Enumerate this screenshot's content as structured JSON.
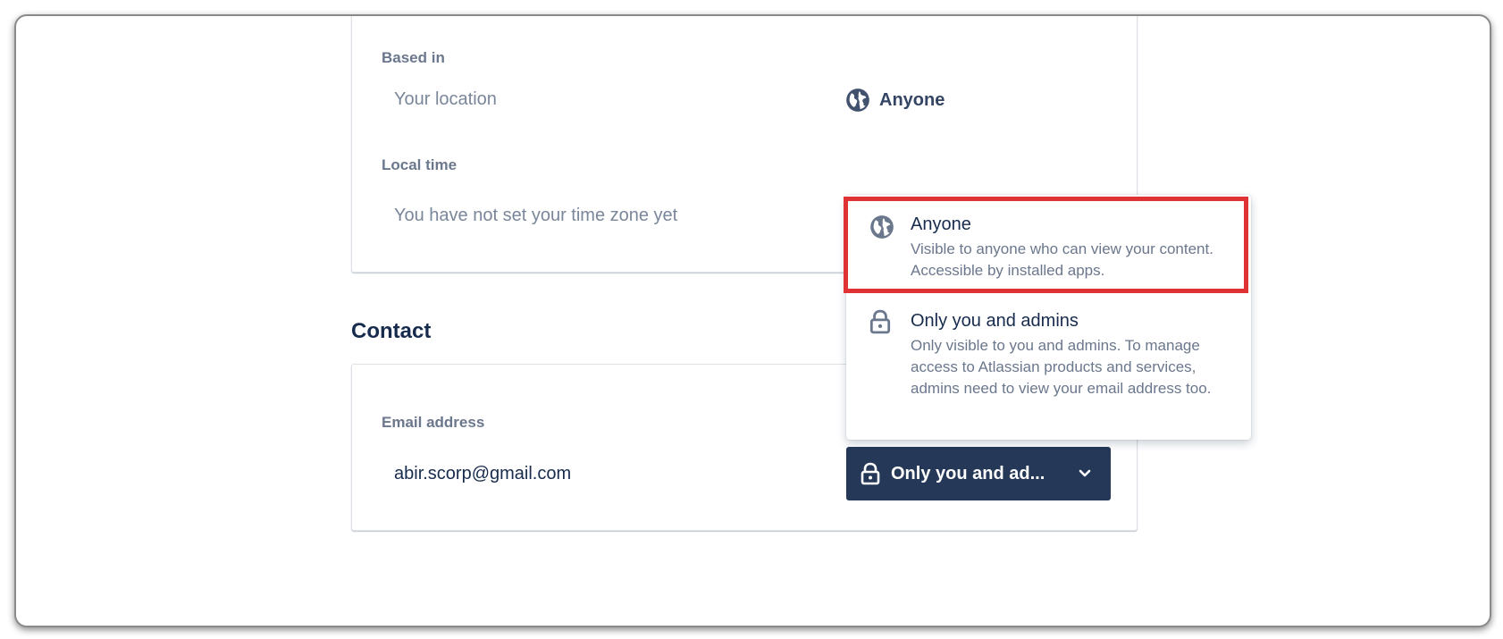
{
  "profile": {
    "based_in": {
      "label": "Based in",
      "placeholder": "Your location",
      "visibility": "Anyone"
    },
    "local_time": {
      "label": "Local time",
      "placeholder": "You have not set your time zone yet"
    }
  },
  "contact": {
    "section_title": "Contact",
    "email": {
      "label": "Email address",
      "value": "abir.scorp@gmail.com",
      "visibility_button": "Only you and ad..."
    }
  },
  "visibility_menu": {
    "options": [
      {
        "title": "Anyone",
        "description": "Visible to anyone who can view your content. Accessible by installed apps.",
        "icon": "globe-icon"
      },
      {
        "title": "Only you and admins",
        "description": "Only visible to you and admins. To manage access to Atlassian products and services, admins need to view your email address too.",
        "icon": "lock-icon"
      }
    ]
  },
  "colors": {
    "primary_text": "#172b4d",
    "secondary_text": "#6b778c",
    "button_bg": "#253858",
    "highlight": "#e03234"
  }
}
